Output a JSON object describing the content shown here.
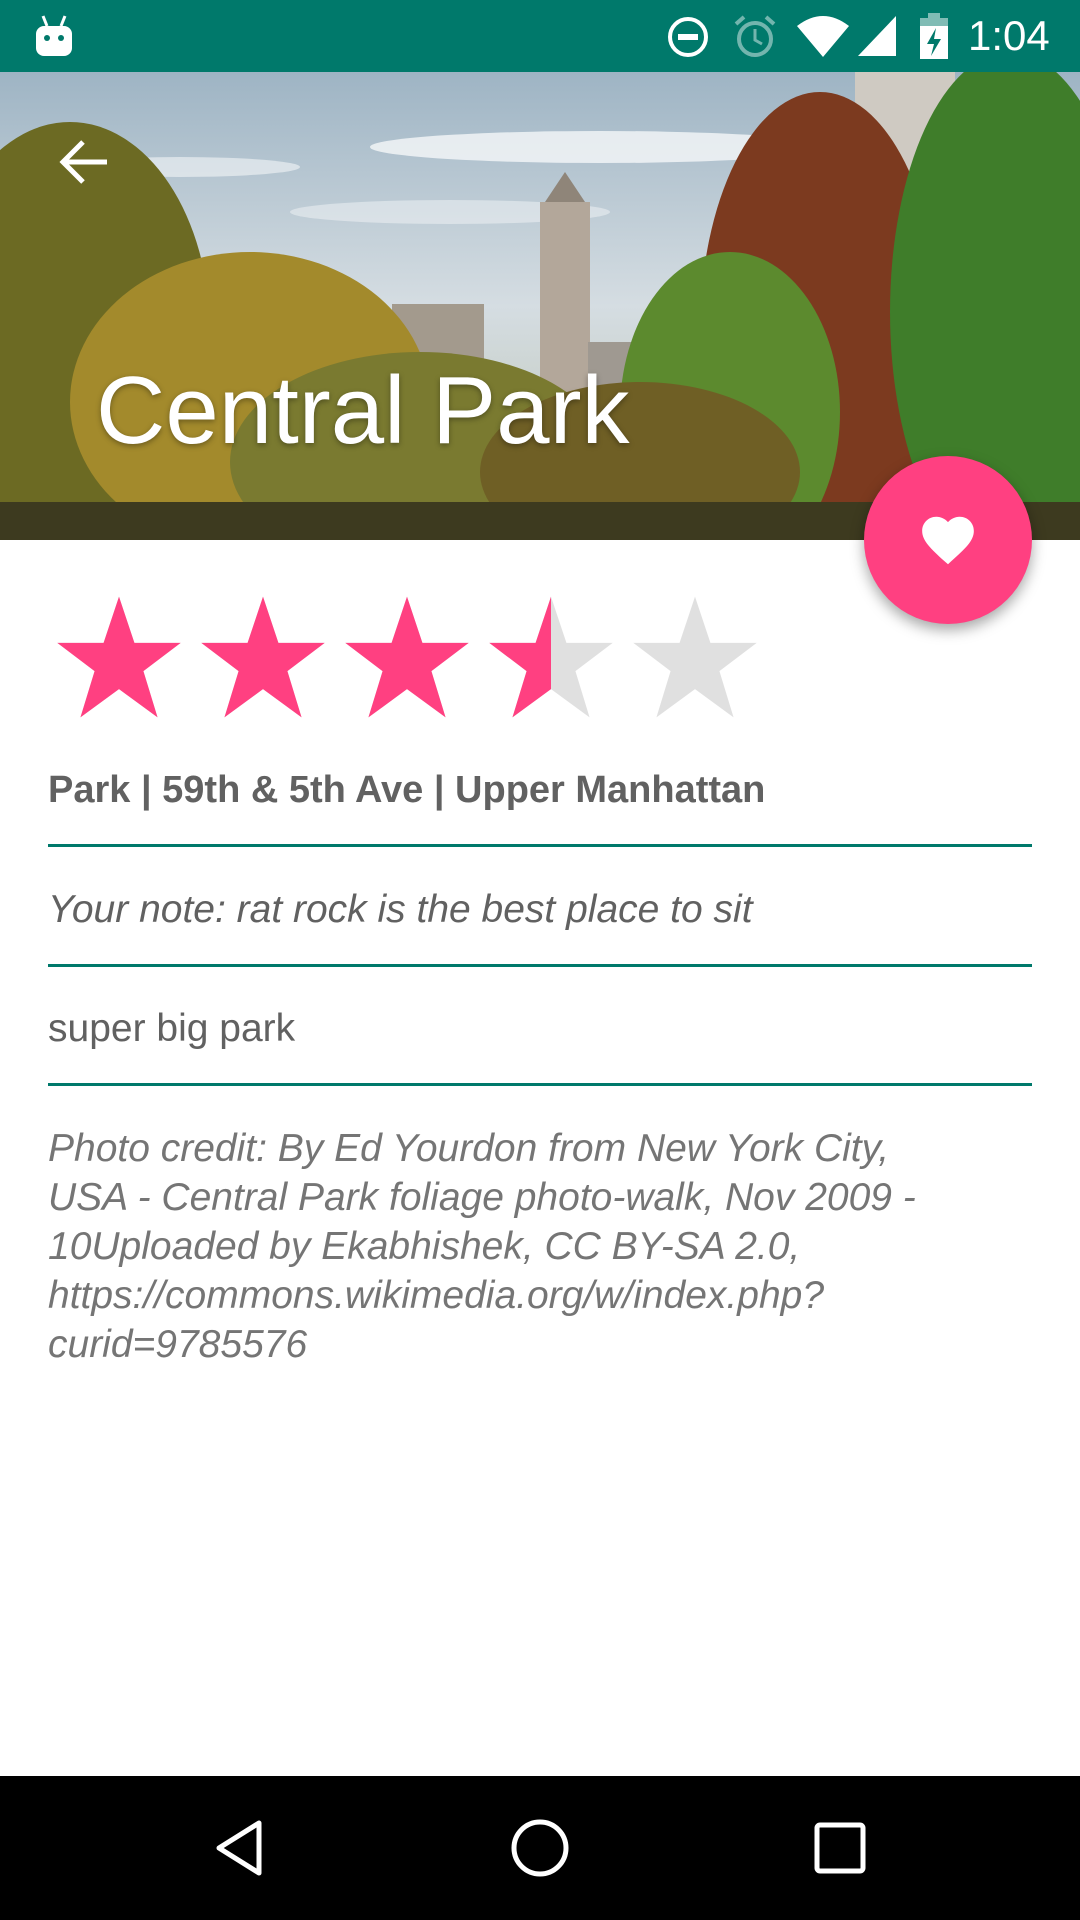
{
  "status_bar": {
    "time": "1:04",
    "icons": [
      "android-icon",
      "do-not-disturb-icon",
      "alarm-icon",
      "wifi-icon",
      "signal-icon",
      "battery-charging-icon"
    ]
  },
  "header": {
    "title": "Central Park",
    "back_icon": "arrow-back-icon"
  },
  "fab": {
    "icon": "heart-icon",
    "color": "#ff4081"
  },
  "rating": {
    "value": 3.5,
    "max": 5,
    "filled_color": "#ff4081",
    "empty_color": "#e0e0e0"
  },
  "details": {
    "info_line": "Park | 59th & 5th Ave | Upper Manhattan",
    "note": "Your note: rat rock is the best place to sit",
    "description": "super big park",
    "photo_credit": "Photo credit: By Ed Yourdon from New York City, USA - Central Park foliage photo-walk, Nov 2009 - 10Uploaded by Ekabhishek, CC BY-SA 2.0, https://commons.wikimedia.org/w/index.php?curid=9785576"
  },
  "nav_bar": {
    "icons": [
      "back-triangle-icon",
      "home-circle-icon",
      "recents-square-icon"
    ]
  },
  "colors": {
    "primary_dark": "#00796b",
    "accent": "#ff4081",
    "text_secondary": "#616161"
  }
}
